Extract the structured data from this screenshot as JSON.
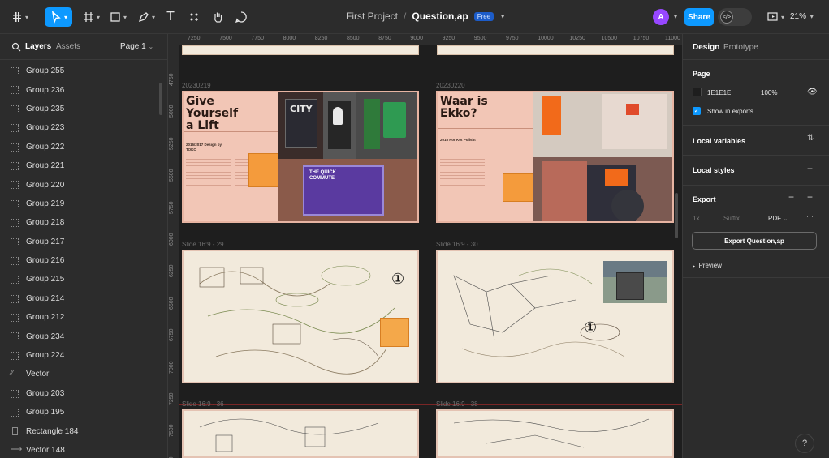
{
  "toolbar": {
    "file_project": "First Project",
    "file_separator": "/",
    "file_name": "Question,ap",
    "plan_badge": "Free",
    "avatar_initial": "A",
    "share_label": "Share",
    "zoom_level": "21%",
    "accent_color": "#0d99ff"
  },
  "layers_panel": {
    "tab_layers": "Layers",
    "tab_assets": "Assets",
    "page_label": "Page 1",
    "items": [
      {
        "name": "Group 255",
        "type": "group"
      },
      {
        "name": "Group 236",
        "type": "group"
      },
      {
        "name": "Group 235",
        "type": "group"
      },
      {
        "name": "Group 223",
        "type": "group"
      },
      {
        "name": "Group 222",
        "type": "group"
      },
      {
        "name": "Group 221",
        "type": "group"
      },
      {
        "name": "Group 220",
        "type": "group"
      },
      {
        "name": "Group 219",
        "type": "group"
      },
      {
        "name": "Group 218",
        "type": "group"
      },
      {
        "name": "Group 217",
        "type": "group"
      },
      {
        "name": "Group 216",
        "type": "group"
      },
      {
        "name": "Group 215",
        "type": "group"
      },
      {
        "name": "Group 214",
        "type": "group"
      },
      {
        "name": "Group 212",
        "type": "group"
      },
      {
        "name": "Group 234",
        "type": "group"
      },
      {
        "name": "Group 224",
        "type": "group"
      },
      {
        "name": "Vector",
        "type": "vector"
      },
      {
        "name": "Group 203",
        "type": "group"
      },
      {
        "name": "Group 195",
        "type": "group"
      },
      {
        "name": "Rectangle 184",
        "type": "rectangle"
      },
      {
        "name": "Vector 148",
        "type": "vector"
      }
    ]
  },
  "canvas": {
    "ruler_top": [
      "7250",
      "7500",
      "7750",
      "8000",
      "8250",
      "8500",
      "8750",
      "9000",
      "9250",
      "9500",
      "9750",
      "10000",
      "10250",
      "10500",
      "10750",
      "11000"
    ],
    "ruler_left": [
      "4750",
      "5000",
      "5250",
      "5500",
      "5750",
      "6000",
      "6250",
      "6500",
      "6750",
      "7000",
      "7250",
      "7500",
      "7750"
    ],
    "frame_labels": {
      "f1": "20230219",
      "f2": "20230220",
      "f3": "Slide 16:9 - 29",
      "f4": "Slide 16:9 - 30",
      "f5": "Slide 16:9 - 36",
      "f6": "Slide 16:9 - 38"
    },
    "slide1": {
      "title": "Give Yourself a Lift",
      "subtitle": "2016/2017 Design by TOKO",
      "sign_city": "CITY",
      "sign_quick": "THE QUICK COMMUTE"
    },
    "slide2": {
      "title": "Waar is Ekko?",
      "subtitle": "2015 Por Kot Pollsbt"
    },
    "sketch_number": "①"
  },
  "design_panel": {
    "tab_design": "Design",
    "tab_prototype": "Prototype",
    "page_section": "Page",
    "bg_hex": "1E1E1E",
    "bg_opacity": "100%",
    "show_in_exports": "Show in exports",
    "local_variables": "Local variables",
    "local_styles": "Local styles",
    "export_section": "Export",
    "export_scale": "1x",
    "export_suffix": "Suffix",
    "export_format": "PDF",
    "export_button": "Export Question,ap",
    "preview": "Preview"
  },
  "help_label": "?"
}
